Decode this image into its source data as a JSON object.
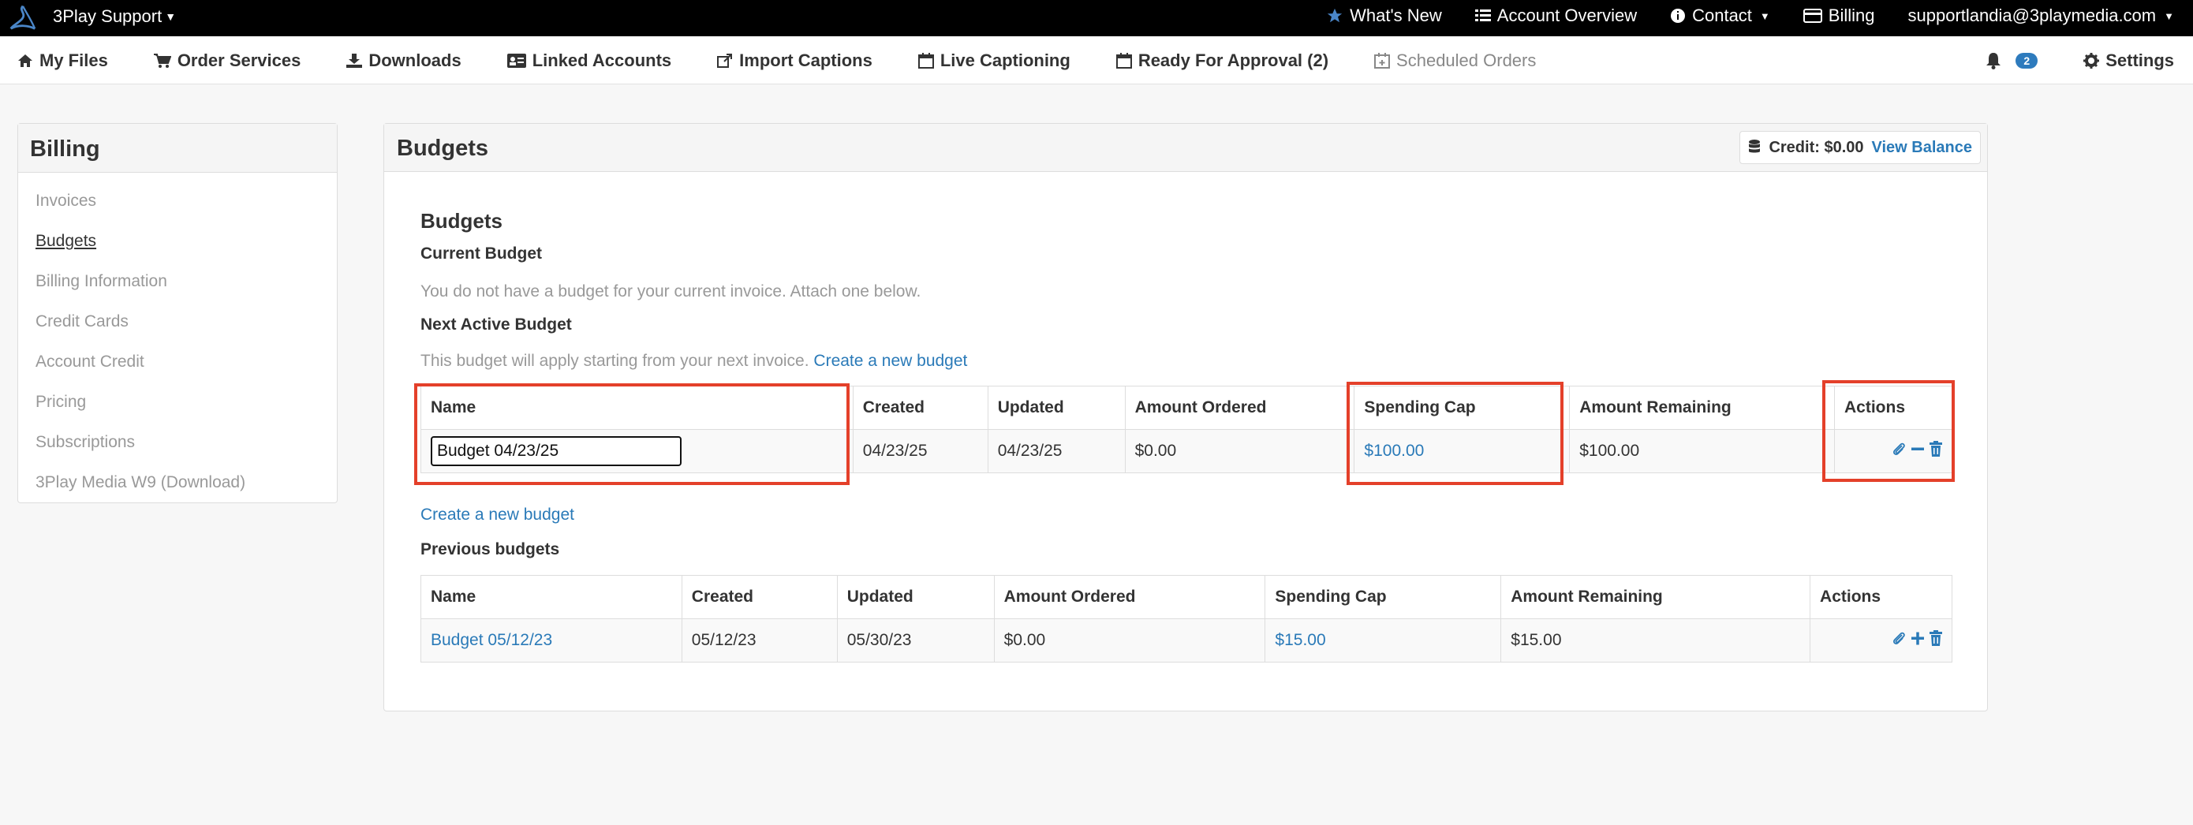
{
  "topbar": {
    "brand": "3Play Support",
    "links": {
      "whats_new": "What's New",
      "account_overview": "Account Overview",
      "contact": "Contact",
      "billing": "Billing",
      "user_email": "supportlandia@3playmedia.com"
    }
  },
  "nav": {
    "my_files": "My Files",
    "order_services": "Order Services",
    "downloads": "Downloads",
    "linked_accounts": "Linked Accounts",
    "import_captions": "Import Captions",
    "live_captioning": "Live Captioning",
    "ready_for_approval": "Ready For Approval (2)",
    "scheduled_orders": "Scheduled Orders",
    "notification_count": "2",
    "settings": "Settings"
  },
  "sidebar": {
    "title": "Billing",
    "items": [
      {
        "label": "Invoices",
        "active": false
      },
      {
        "label": "Budgets",
        "active": true
      },
      {
        "label": "Billing Information",
        "active": false
      },
      {
        "label": "Credit Cards",
        "active": false
      },
      {
        "label": "Account Credit",
        "active": false
      },
      {
        "label": "Pricing",
        "active": false
      },
      {
        "label": "Subscriptions",
        "active": false
      },
      {
        "label": "3Play Media W9 (Download)",
        "active": false
      }
    ]
  },
  "panel": {
    "title": "Budgets",
    "credit_label": "Credit: $0.00",
    "view_balance": "View Balance",
    "section_title": "Budgets",
    "current_budget_heading": "Current Budget",
    "current_budget_note": "You do not have a budget for your current invoice. Attach one below.",
    "next_budget_heading": "Next Active Budget",
    "next_budget_note": "This budget will apply starting from your next invoice.",
    "create_new_budget_link": "Create a new budget",
    "create_new_budget_link_2": "Create a new budget",
    "previous_heading": "Previous budgets"
  },
  "columns": {
    "name": "Name",
    "created": "Created",
    "updated": "Updated",
    "amount_ordered": "Amount Ordered",
    "spending_cap": "Spending Cap",
    "amount_remaining": "Amount Remaining",
    "actions": "Actions"
  },
  "next_budget_row": {
    "name": "Budget 04/23/25",
    "created": "04/23/25",
    "updated": "04/23/25",
    "amount_ordered": "$0.00",
    "spending_cap": "$100.00",
    "amount_remaining": "$100.00"
  },
  "previous_budget_row": {
    "name": "Budget 05/12/23",
    "created": "05/12/23",
    "updated": "05/30/23",
    "amount_ordered": "$0.00",
    "spending_cap": "$15.00",
    "amount_remaining": "$15.00"
  },
  "colors": {
    "link": "#2a7ab8",
    "highlight": "#e4402a",
    "badge": "#2e7bbd"
  }
}
